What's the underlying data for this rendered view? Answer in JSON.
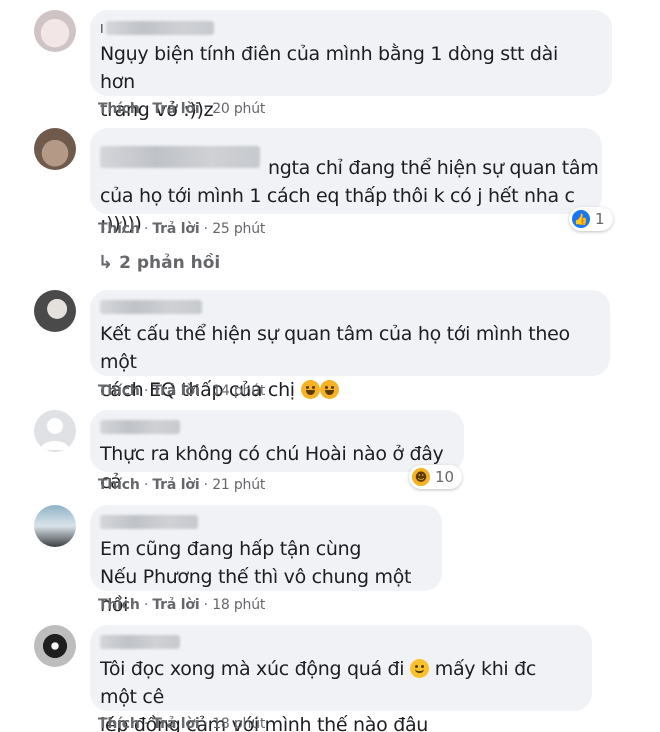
{
  "labels": {
    "like": "Thích",
    "reply": "Trả lời",
    "sep": " · "
  },
  "comments": [
    {
      "name_initial": "I",
      "text": "Ngụy biện tính điên của mình bằng 1 dòng stt dài hơn\ntrang vở :))z",
      "time": "20 phút"
    },
    {
      "text": "ngta chỉ đang thể hiện sự quan tâm\ncủa họ tới mình 1 cách eq thấp thôi k có j hết nha c :)))))",
      "time": "25 phút",
      "reaction": {
        "icon": "like-icon",
        "count": "1"
      },
      "replies": "2 phản hồi"
    },
    {
      "text": "Kết cấu thể hiện sự quan tâm của họ tới mình theo một\ncách EQ thấp của chị",
      "time": "14 phút",
      "inline_emojis": [
        "laughing-emoji",
        "laughing-emoji"
      ]
    },
    {
      "text": "Thực ra không có chú Hoài nào ở đây cả",
      "time": "21 phút",
      "reaction": {
        "icon": "haha-icon",
        "count": "10"
      }
    },
    {
      "text": "Em cũng đang hấp tận cùng\nNếu Phương thế thì vô chung một nồi",
      "time": "18 phút"
    },
    {
      "text_before_emoji": "Tôi đọc xong mà xúc động quá đi ",
      "text_after_emoji": " mấy khi đc một cê\nlép đồng cảm với mình thế nào đâu",
      "time": "18 phút",
      "inline_emojis": [
        "smile-emoji"
      ]
    }
  ]
}
